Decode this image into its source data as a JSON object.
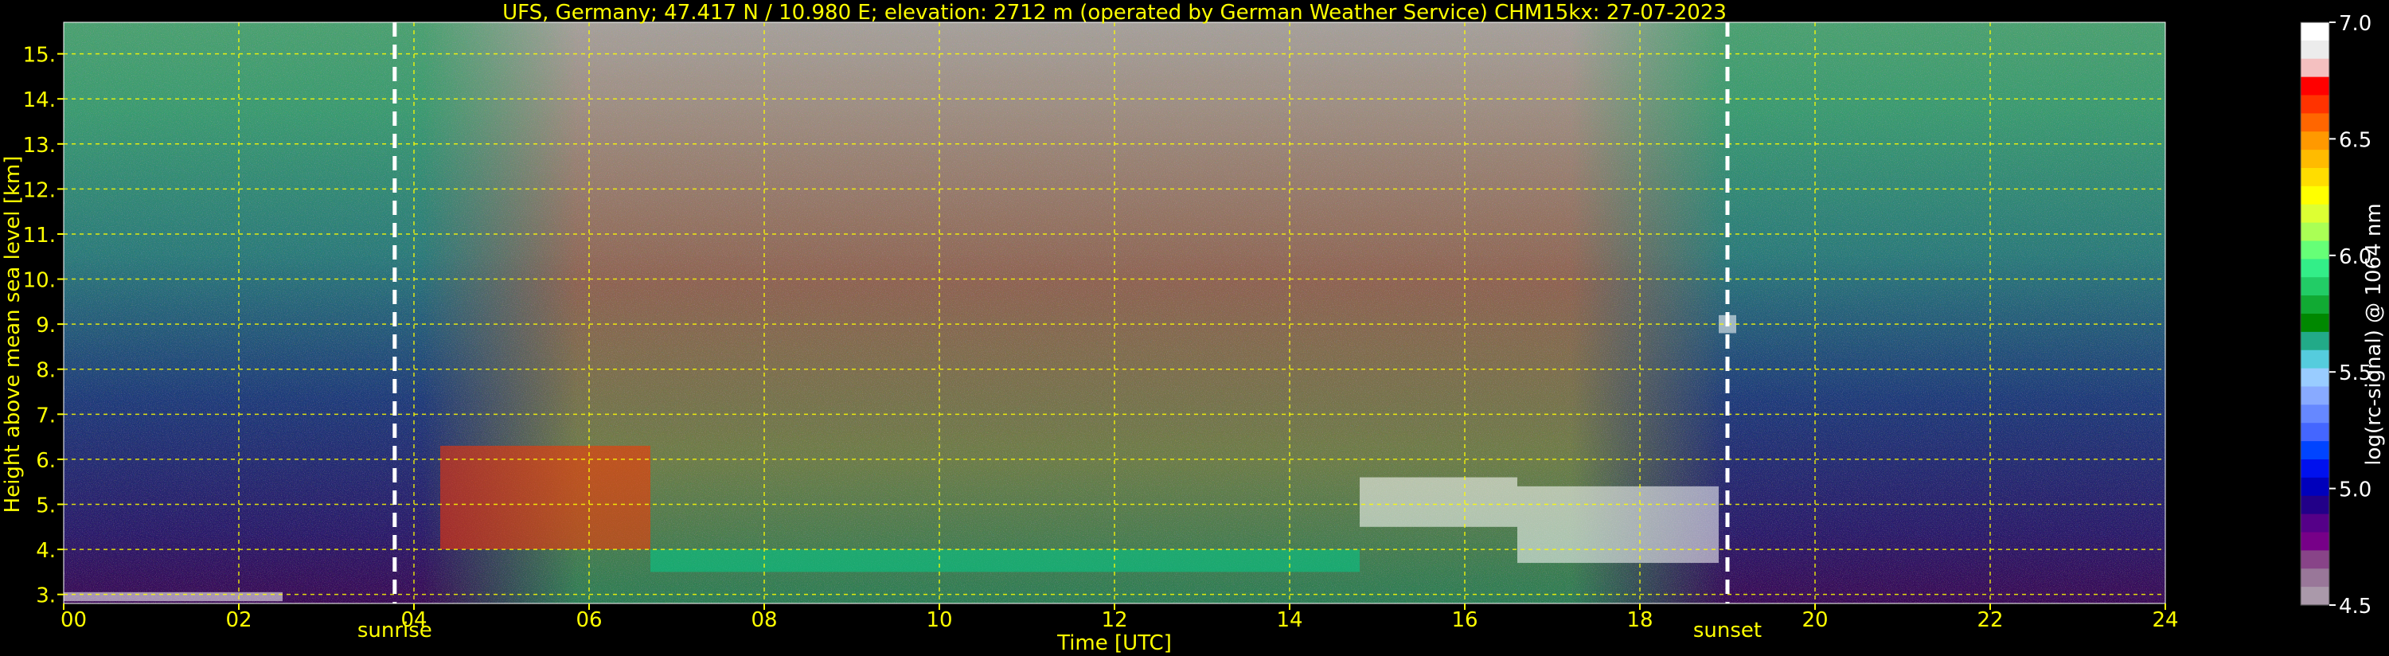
{
  "chart_data": {
    "type": "heatmap",
    "title": "UFS, Germany; 47.417 N / 10.980 E; elevation: 2712 m  (operated by German Weather Service)    CHM15kx: 27-07-2023",
    "xlabel": "Time [UTC]",
    "ylabel": "Height above mean sea level [km]",
    "xlim": [
      0,
      24
    ],
    "ylim": [
      2.8,
      15.7
    ],
    "x_ticks": [
      "00",
      "02",
      "04",
      "06",
      "08",
      "10",
      "12",
      "14",
      "16",
      "18",
      "20",
      "22",
      "24"
    ],
    "y_ticks": [
      "3.",
      "4.",
      "5.",
      "6.",
      "7.",
      "8.",
      "9.",
      "10.",
      "11.",
      "12.",
      "13.",
      "14.",
      "15."
    ],
    "grid": true,
    "markers": [
      {
        "label": "sunrise",
        "x": 3.78
      },
      {
        "label": "sunset",
        "x": 19.0
      }
    ],
    "colorbar": {
      "label": "log(rc-signal) @ 1064 nm",
      "range": [
        4.5,
        7.0
      ],
      "ticks": [
        "7.0",
        "6.5",
        "6.0",
        "5.5",
        "5.0",
        "4.5"
      ],
      "colors": [
        "#ffffff",
        "#ececec",
        "#f4c0c0",
        "#ff0000",
        "#ff3300",
        "#ff6600",
        "#ff9900",
        "#ffbb00",
        "#ffdd00",
        "#ffff00",
        "#ddff33",
        "#aaff55",
        "#66ff77",
        "#33ee88",
        "#22cc66",
        "#11aa33",
        "#008800",
        "#22aa88",
        "#55ccdd",
        "#99ccff",
        "#88aaff",
        "#6688ff",
        "#4466ff",
        "#0044ff",
        "#0011ee",
        "#0000bb",
        "#220088",
        "#550088",
        "#770088",
        "#884488",
        "#997799",
        "#aa99aa"
      ]
    },
    "layers": [
      {
        "t": [
          0.0,
          2.5
        ],
        "h": [
          2.85,
          3.05
        ]
      },
      {
        "t": [
          4.3,
          6.7
        ],
        "h": [
          4.0,
          6.3
        ]
      },
      {
        "t": [
          6.7,
          14.8
        ],
        "h": [
          3.5,
          4.0
        ]
      },
      {
        "t": [
          14.8,
          16.6
        ],
        "h": [
          4.5,
          5.6
        ]
      },
      {
        "t": [
          16.6,
          18.9
        ],
        "h": [
          3.7,
          5.4
        ]
      },
      {
        "t": [
          18.9,
          19.1
        ],
        "h": [
          8.8,
          9.2
        ]
      }
    ]
  }
}
